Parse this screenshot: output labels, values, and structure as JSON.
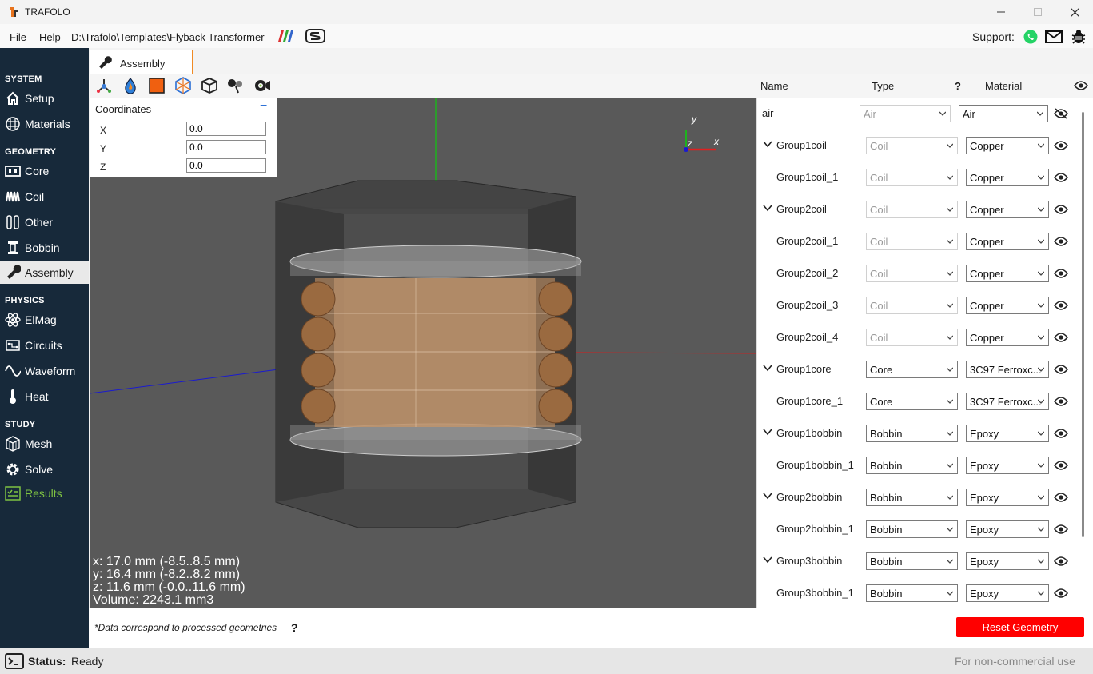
{
  "app": {
    "title": "TRAFOLO"
  },
  "menu": {
    "file": "File",
    "help": "Help",
    "path": "D:\\Trafolo\\Templates\\Flyback Transformer",
    "support_label": "Support:"
  },
  "sidebar": {
    "sections": {
      "system": "SYSTEM",
      "geometry": "GEOMETRY",
      "physics": "PHYSICS",
      "study": "STUDY"
    },
    "items": {
      "setup": "Setup",
      "materials": "Materials",
      "core": "Core",
      "coil": "Coil",
      "other": "Other",
      "bobbin": "Bobbin",
      "assembly": "Assembly",
      "elmag": "ElMag",
      "circuits": "Circuits",
      "waveform": "Waveform",
      "heat": "Heat",
      "mesh": "Mesh",
      "solve": "Solve",
      "results": "Results"
    }
  },
  "tab": {
    "label": "Assembly"
  },
  "coordinates": {
    "title": "Coordinates",
    "collapse": "−",
    "x_label": "X",
    "x_value": "0.0",
    "y_label": "Y",
    "y_value": "0.0",
    "z_label": "Z",
    "z_value": "0.0"
  },
  "viewport": {
    "dim_x": "x: 17.0 mm (-8.5..8.5 mm)",
    "dim_y": "y: 16.4 mm (-8.2..8.2 mm)",
    "dim_z": "z: 11.6 mm (-0.0..11.6 mm)",
    "volume": "Volume: 2243.1 mm3",
    "axis_y": "y",
    "axis_x": "x",
    "axis_z": "z"
  },
  "table": {
    "headers": {
      "name": "Name",
      "type": "Type",
      "help": "?",
      "material": "Material"
    },
    "rows": [
      {
        "name": "air",
        "type": "Air",
        "material": "Air",
        "group": false,
        "type_enabled": false,
        "hidden": true
      },
      {
        "name": "Group1coil",
        "type": "Coil",
        "material": "Copper",
        "group": true,
        "type_enabled": false,
        "hidden": false
      },
      {
        "name": "Group1coil_1",
        "type": "Coil",
        "material": "Copper",
        "group": false,
        "type_enabled": false,
        "hidden": false
      },
      {
        "name": "Group2coil",
        "type": "Coil",
        "material": "Copper",
        "group": true,
        "type_enabled": false,
        "hidden": false
      },
      {
        "name": "Group2coil_1",
        "type": "Coil",
        "material": "Copper",
        "group": false,
        "type_enabled": false,
        "hidden": false
      },
      {
        "name": "Group2coil_2",
        "type": "Coil",
        "material": "Copper",
        "group": false,
        "type_enabled": false,
        "hidden": false
      },
      {
        "name": "Group2coil_3",
        "type": "Coil",
        "material": "Copper",
        "group": false,
        "type_enabled": false,
        "hidden": false
      },
      {
        "name": "Group2coil_4",
        "type": "Coil",
        "material": "Copper",
        "group": false,
        "type_enabled": false,
        "hidden": false
      },
      {
        "name": "Group1core",
        "type": "Core",
        "material": "3C97 Ferroxc...",
        "group": true,
        "type_enabled": true,
        "hidden": false
      },
      {
        "name": "Group1core_1",
        "type": "Core",
        "material": "3C97 Ferroxc...",
        "group": false,
        "type_enabled": true,
        "hidden": false
      },
      {
        "name": "Group1bobbin",
        "type": "Bobbin",
        "material": "Epoxy",
        "group": true,
        "type_enabled": true,
        "hidden": false
      },
      {
        "name": "Group1bobbin_1",
        "type": "Bobbin",
        "material": "Epoxy",
        "group": false,
        "type_enabled": true,
        "hidden": false
      },
      {
        "name": "Group2bobbin",
        "type": "Bobbin",
        "material": "Epoxy",
        "group": true,
        "type_enabled": true,
        "hidden": false
      },
      {
        "name": "Group2bobbin_1",
        "type": "Bobbin",
        "material": "Epoxy",
        "group": false,
        "type_enabled": true,
        "hidden": false
      },
      {
        "name": "Group3bobbin",
        "type": "Bobbin",
        "material": "Epoxy",
        "group": true,
        "type_enabled": true,
        "hidden": false
      },
      {
        "name": "Group3bobbin_1",
        "type": "Bobbin",
        "material": "Epoxy",
        "group": false,
        "type_enabled": true,
        "hidden": false
      }
    ]
  },
  "bottom": {
    "note": "*Data correspond to processed geometries",
    "note_help": "?",
    "reset_button": "Reset Geometry"
  },
  "status": {
    "label": "Status:",
    "value": "Ready",
    "license": "For non-commercial use"
  },
  "colors": {
    "sidebar": "#17293a",
    "accent": "#f08a24",
    "reset": "#ff0000",
    "results": "#7ec242"
  }
}
